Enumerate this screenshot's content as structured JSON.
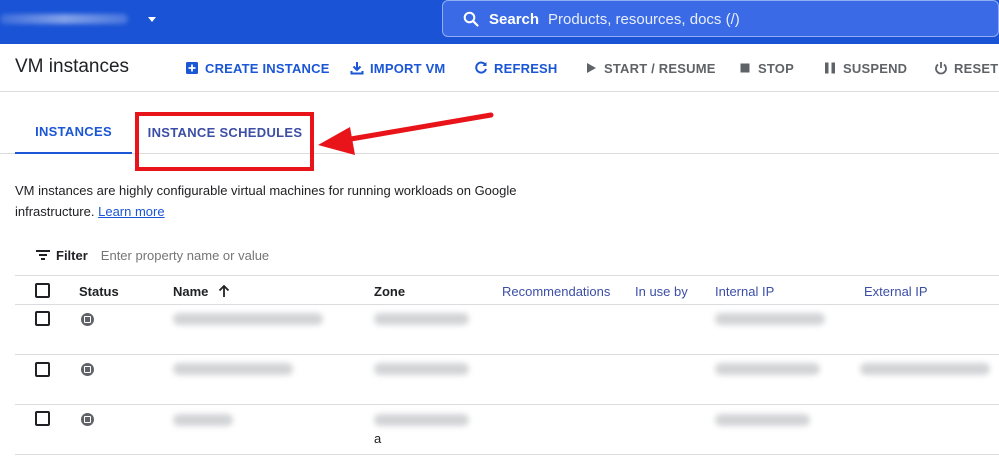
{
  "search": {
    "label": "Search",
    "placeholder": "Products, resources, docs (/)"
  },
  "toolbar": {
    "title": "VM instances",
    "buttons": [
      {
        "label": "CREATE INSTANCE",
        "icon": "add-box-icon"
      },
      {
        "label": "IMPORT VM",
        "icon": "download-icon"
      },
      {
        "label": "REFRESH",
        "icon": "refresh-icon"
      },
      {
        "label": "START / RESUME",
        "icon": "play-icon"
      },
      {
        "label": "STOP",
        "icon": "stop-icon"
      },
      {
        "label": "SUSPEND",
        "icon": "pause-icon"
      },
      {
        "label": "RESET",
        "icon": "power-icon"
      }
    ]
  },
  "tabs": [
    {
      "label": "INSTANCES",
      "active": true
    },
    {
      "label": "INSTANCE SCHEDULES",
      "active": false,
      "highlighted": true
    }
  ],
  "description": {
    "text": "VM instances are highly configurable virtual machines for running workloads on Google infrastructure.",
    "link": "Learn more"
  },
  "filter": {
    "label": "Filter",
    "placeholder": "Enter property name or value"
  },
  "table": {
    "columns": [
      "Status",
      "Name",
      "Zone",
      "Recommendations",
      "In use by",
      "Internal IP",
      "External IP"
    ],
    "sort_indicator": "arrow-up-icon",
    "rows": [
      {
        "status": "stopped",
        "zone_suffix": ""
      },
      {
        "status": "stopped",
        "zone_suffix": ""
      },
      {
        "status": "stopped",
        "zone_suffix": "a"
      }
    ]
  },
  "colors": {
    "topbar": "#1a53d6",
    "accent": "#1a56d6",
    "annotation": "#e8141a"
  }
}
